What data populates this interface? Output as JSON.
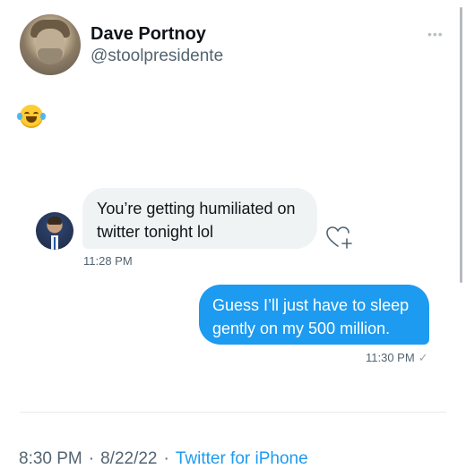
{
  "profile": {
    "name": "Dave Portnoy",
    "handle": "@stoolpresidente"
  },
  "tweet": {
    "emoji_icon": "face-with-tears-of-joy-icon"
  },
  "conversation": {
    "incoming": {
      "text_line1": "You’re getting humiliated on",
      "text_line2": "twitter tonight lol",
      "time": "11:28 PM"
    },
    "outgoing": {
      "text_line1": "Guess I’ll just have to sleep",
      "text_line2": "gently on my 500 million.",
      "time": "11:30 PM",
      "status_icon": "sent-check-icon"
    }
  },
  "footer": {
    "time": "8:30 PM",
    "separator": "·",
    "date": "8/22/22",
    "source": "Twitter for iPhone"
  },
  "colors": {
    "accent": "#1d9bf0",
    "incoming_bubble": "#eff3f4",
    "secondary_text": "#536471"
  }
}
